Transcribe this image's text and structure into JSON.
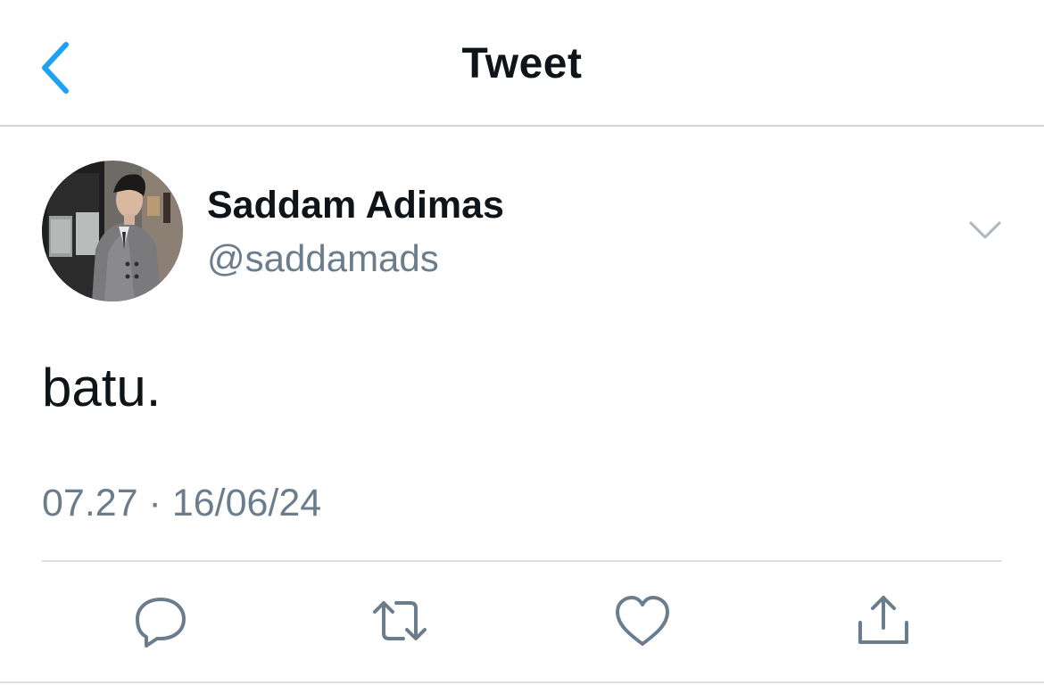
{
  "header": {
    "title": "Tweet",
    "back_icon": "chevron-left-icon"
  },
  "author": {
    "name": "Saddam Adimas",
    "handle": "@saddamads"
  },
  "tweet": {
    "text": "batu.",
    "timestamp": "07.27 · 16/06/24"
  },
  "actions": [
    {
      "name": "reply",
      "icon": "reply-icon"
    },
    {
      "name": "retweet",
      "icon": "retweet-icon"
    },
    {
      "name": "like",
      "icon": "heart-icon"
    },
    {
      "name": "share",
      "icon": "share-icon"
    }
  ],
  "colors": {
    "accent": "#1da1f2",
    "text_primary": "#0f1419",
    "text_secondary": "#6b7d8c",
    "icon": "#6b7d8c",
    "divider": "#d9dfe4"
  }
}
